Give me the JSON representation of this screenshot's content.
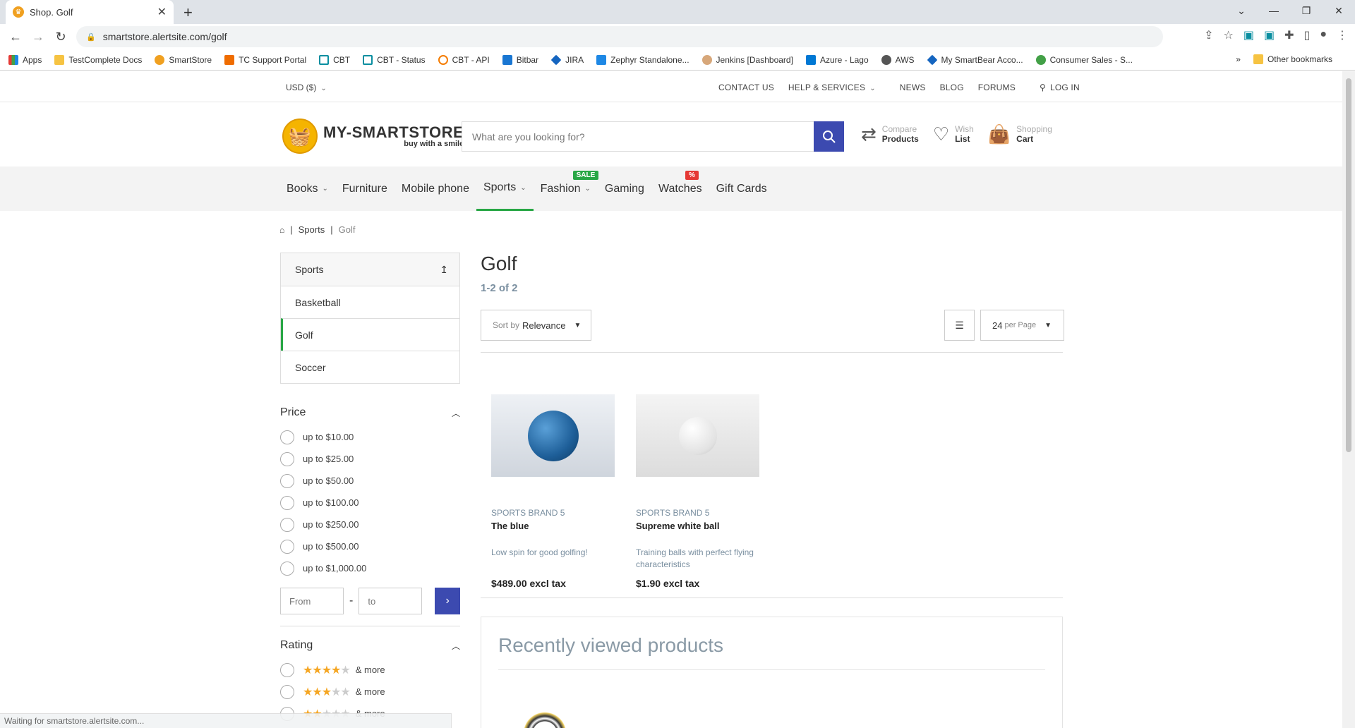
{
  "browser": {
    "tab_title": "Shop. Golf",
    "url": "smartstore.alertsite.com/golf",
    "bookmarks": [
      "Apps",
      "TestComplete Docs",
      "SmartStore",
      "TC Support Portal",
      "CBT",
      "CBT - Status",
      "CBT - API",
      "Bitbar",
      "JIRA",
      "Zephyr Standalone...",
      "Jenkins [Dashboard]",
      "Azure - Lago",
      "AWS",
      "My SmartBear Acco...",
      "Consumer Sales - S..."
    ],
    "more_bookmarks": "»",
    "other_bookmarks": "Other bookmarks",
    "status": "Waiting for smartstore.alertsite.com..."
  },
  "topbar": {
    "currency": "USD ($)",
    "contact": "CONTACT US",
    "help": "HELP & SERVICES",
    "news": "NEWS",
    "blog": "BLOG",
    "forums": "FORUMS",
    "login": "LOG IN"
  },
  "header": {
    "logo_title": "MY-SMARTSTORE",
    "logo_tagline": "buy with a smile",
    "search_placeholder": "What are you looking for?",
    "compare_small": "Compare",
    "compare_bold": "Products",
    "wish_small": "Wish",
    "wish_bold": "List",
    "cart_small": "Shopping",
    "cart_bold": "Cart"
  },
  "nav": {
    "items": [
      "Books",
      "Furniture",
      "Mobile phone",
      "Sports",
      "Fashion",
      "Gaming",
      "Watches",
      "Gift Cards"
    ],
    "sale_badge": "SALE",
    "pct_badge": "%",
    "active": "Sports"
  },
  "breadcrumb": {
    "sep": "|",
    "level1": "Sports",
    "level2": "Golf"
  },
  "sidebar": {
    "categories": [
      "Sports",
      "Basketball",
      "Golf",
      "Soccer"
    ],
    "active_category": "Golf",
    "price_title": "Price",
    "price_options": [
      "up to $10.00",
      "up to $25.00",
      "up to $50.00",
      "up to $100.00",
      "up to $250.00",
      "up to $500.00",
      "up to $1,000.00"
    ],
    "from_placeholder": "From",
    "to_placeholder": "to",
    "range_sep": "-",
    "rating_title": "Rating",
    "rating_options": [
      {
        "stars": 4,
        "label": "& more"
      },
      {
        "stars": 3,
        "label": "& more"
      },
      {
        "stars": 2,
        "label": "& more"
      }
    ]
  },
  "main": {
    "title": "Golf",
    "count": "1-2 of 2",
    "sort_prefix": "Sort by",
    "sort_value": "Relevance",
    "per_page_value": "24",
    "per_page_label": "per Page",
    "products": [
      {
        "brand": "SPORTS BRAND 5",
        "name": "The blue",
        "desc": "Low spin for good golfing!",
        "price": "$489.00 excl tax"
      },
      {
        "brand": "SPORTS BRAND 5",
        "name": "Supreme white ball",
        "desc": "Training balls with perfect flying characteristics",
        "price": "$1.90 excl tax"
      }
    ],
    "recent_title": "Recently viewed products"
  }
}
